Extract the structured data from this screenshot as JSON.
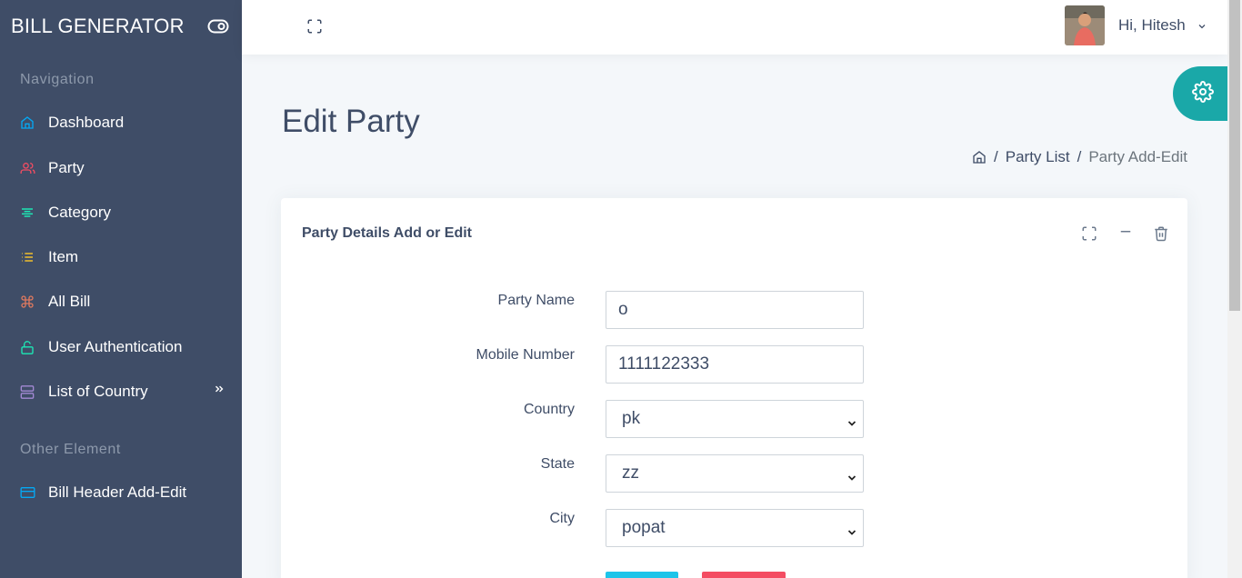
{
  "app": {
    "brand": "BILL GENERATOR"
  },
  "sidebar": {
    "caption_nav": "Navigation",
    "caption_other": "Other Element",
    "items": [
      {
        "label": "Dashboard",
        "icon": "home-icon",
        "color": "#04a9f5"
      },
      {
        "label": "Party",
        "icon": "users-icon",
        "color": "#f44c62"
      },
      {
        "label": "Category",
        "icon": "align-center-icon",
        "color": "#1de9b6"
      },
      {
        "label": "Item",
        "icon": "list-icon",
        "color": "#f4c22b"
      },
      {
        "label": "All Bill",
        "icon": "command-icon",
        "color": "#e07a5f"
      },
      {
        "label": "User Authentication",
        "icon": "unlock-icon",
        "color": "#1de9b6"
      },
      {
        "label": "List of Country",
        "icon": "server-icon",
        "color": "#a389d4"
      }
    ],
    "other_items": [
      {
        "label": "Bill Header Add-Edit",
        "icon": "credit-card-icon",
        "color": "#04a9f5"
      }
    ]
  },
  "header": {
    "greeting": "Hi, Hitesh"
  },
  "page": {
    "title": "Edit Party",
    "breadcrumb": {
      "link": "Party List",
      "current": "Party Add-Edit",
      "separator": "/"
    }
  },
  "card": {
    "title": "Party Details Add or Edit",
    "fields": {
      "party_name": {
        "label": "Party Name",
        "value": "o"
      },
      "mobile": {
        "label": "Mobile Number",
        "value": "1111122333"
      },
      "country": {
        "label": "Country",
        "value": "pk"
      },
      "state": {
        "label": "State",
        "value": "zz"
      },
      "city": {
        "label": "City",
        "value": "popat"
      }
    }
  },
  "colors": {
    "sidebar_bg": "#3f4d67",
    "accent_teal": "#1aa8a8",
    "button_save": "#1dc4e9",
    "button_cancel": "#f44c62"
  }
}
